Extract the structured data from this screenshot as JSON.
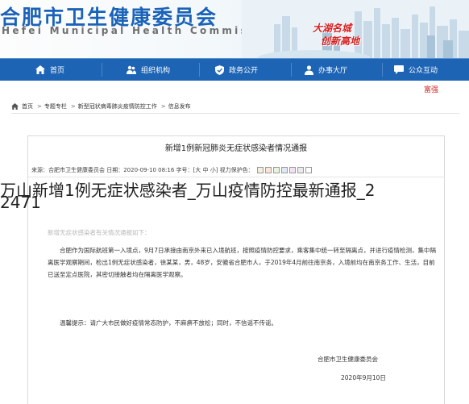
{
  "header": {
    "title": "合肥市卫生健康委员会",
    "subtitle": "Hefei Municipal Health Commission",
    "slogan_1": "大湖名城",
    "slogan_2": "创新高地"
  },
  "nav": {
    "items": [
      {
        "label": "首页",
        "icon": "home-icon"
      },
      {
        "label": "组织机构",
        "icon": "people-icon"
      },
      {
        "label": "政务公开",
        "icon": "shield-icon"
      },
      {
        "label": "办事大厅",
        "icon": "person-icon"
      },
      {
        "label": "公众互动",
        "icon": "chat-icon"
      }
    ]
  },
  "font_size_label": "富强",
  "breadcrumb": {
    "items": [
      "首页",
      "专题专栏",
      "新型冠状病毒肺炎疫情防控工作",
      "信息发布"
    ],
    "separator": ">"
  },
  "article": {
    "title": "新增1例新冠肺炎无症状感染者情况通报",
    "meta": "来源：合肥市卫生健康委员会 日期：2020-09-10 08:16 字号：[大 中 小] 视力保护色：",
    "protect_colors": [
      "#f4eee0",
      "#fde6d8",
      "#e9f4d9",
      "#dfe9f6",
      "#f0e2f2",
      "#eaeaea",
      "#ffffff"
    ],
    "overlay_line_1": "万山新增1例无症状感染者_万山疫情防控最新通报_2",
    "overlay_line_2": "2471",
    "faded_line": "新增无症状感染者有关情况通报如下：",
    "paragraph_1": "合肥作为国际航班第一入境点，9月7日承接由南京外来已入境航班，按照疫情防控要求，乘客集中统一转至隔离点，并进行疫情检测，集中隔离医学观察期间，检出1例无症状感染者，徐某某，男，48岁，安徽省合肥市人，于2019年4月前往南京务，入境前均在南京务工作、生活，目前已送至定点医院，其密切接触者均在隔离医学观察。",
    "paragraph_2": "温馨提示：请广大市民做好疫情常态防护，不麻痹不放松；同时，不信谣不传谣。",
    "signature_org": "合肥市卫生健康委员会",
    "signature_date": "2020年9月10日"
  }
}
